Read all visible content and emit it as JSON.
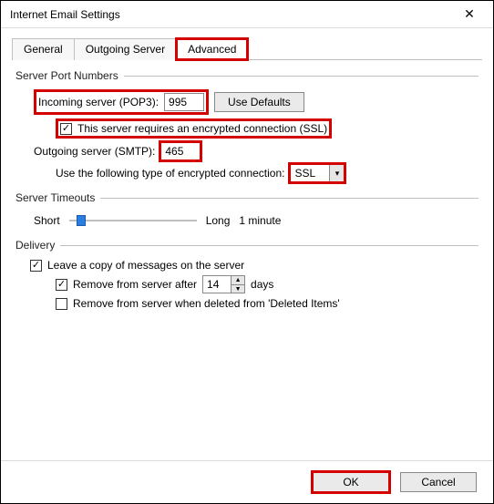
{
  "title": "Internet Email Settings",
  "tabs": {
    "general": "General",
    "outgoing": "Outgoing Server",
    "advanced": "Advanced"
  },
  "sections": {
    "ports": {
      "header": "Server Port Numbers",
      "incoming_label": "Incoming server (POP3):",
      "incoming_port": "995",
      "use_defaults": "Use Defaults",
      "ssl_checkbox": "This server requires an encrypted connection (SSL)",
      "outgoing_label": "Outgoing server (SMTP):",
      "outgoing_port": "465",
      "enc_label": "Use the following type of encrypted connection:",
      "enc_value": "SSL"
    },
    "timeouts": {
      "header": "Server Timeouts",
      "short": "Short",
      "long": "Long",
      "value": "1 minute"
    },
    "delivery": {
      "header": "Delivery",
      "leave_copy": "Leave a copy of messages on the server",
      "remove_after": "Remove from server after",
      "remove_days": "14",
      "days": "days",
      "remove_deleted": "Remove from server when deleted from 'Deleted Items'"
    }
  },
  "buttons": {
    "ok": "OK",
    "cancel": "Cancel"
  },
  "checks": {
    "ssl": true,
    "leave_copy": true,
    "remove_after": true,
    "remove_deleted": false
  }
}
